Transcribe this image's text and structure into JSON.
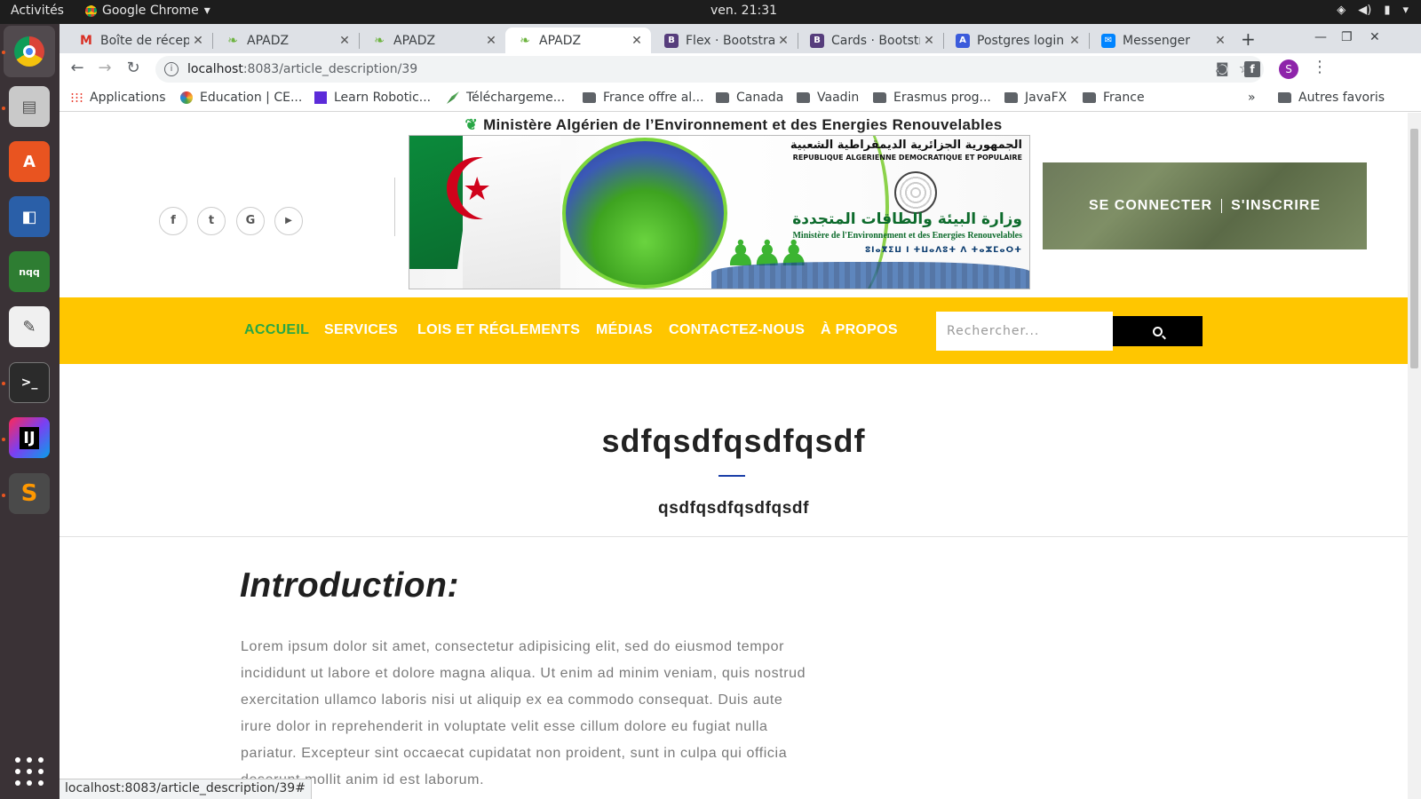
{
  "system": {
    "activities": "Activités",
    "app_name": "Google Chrome",
    "clock": "ven. 21:31"
  },
  "tabs": [
    {
      "label": "Boîte de récept",
      "icon": "gmail-icon",
      "color": "#d93025"
    },
    {
      "label": "APADZ",
      "icon": "leaf-icon",
      "color": "#6db33f"
    },
    {
      "label": "APADZ",
      "icon": "leaf-icon",
      "color": "#6db33f"
    },
    {
      "label": "APADZ",
      "icon": "leaf-icon",
      "color": "#6db33f"
    },
    {
      "label": "Flex · Bootstrap",
      "icon": "bootstrap-icon",
      "color": "#563d7c"
    },
    {
      "label": "Cards · Bootstr",
      "icon": "bootstrap-icon",
      "color": "#563d7c"
    },
    {
      "label": "Postgres login",
      "icon": "a-icon",
      "color": "#3b5bdb"
    },
    {
      "label": "Messenger",
      "icon": "messenger-icon",
      "color": "#0084ff"
    }
  ],
  "omnibox": {
    "host": "localhost",
    "path": ":8083/article_description/39"
  },
  "avatar_letter": "S",
  "bookmarks": [
    {
      "label": "Applications",
      "icon": "apps-grid-icon"
    },
    {
      "label": "Education | CE...",
      "icon": "flower-icon"
    },
    {
      "label": "Learn Robotic...",
      "icon": "e-icon"
    },
    {
      "label": "Téléchargeme...",
      "icon": "rocket-icon"
    },
    {
      "label": "France offre al...",
      "icon": "folder-icon"
    },
    {
      "label": "Canada",
      "icon": "folder-icon"
    },
    {
      "label": "Vaadin",
      "icon": "folder-icon"
    },
    {
      "label": "Erasmus prog...",
      "icon": "folder-icon"
    },
    {
      "label": "JavaFX",
      "icon": "folder-icon"
    },
    {
      "label": "France",
      "icon": "folder-icon"
    }
  ],
  "bookmarks_overflow": "»",
  "other_bookmarks": "Autres favoris",
  "site": {
    "ministry_title": "Ministère Algérien de l’Environnement et des Energies Renouvelables",
    "banner": {
      "ar_republic": "الجمهورية الجزائرية الديمقراطية الشعبية",
      "fr_republic": "REPUBLIQUE ALGERIENNE DEMOCRATIQUE ET POPULAIRE",
      "ar_ministry": "وزارة البيئة والطاقات المتجددة",
      "fr_ministry": "Ministère de l'Environnement et des Energies Renouvelables",
      "tifinagh": "ⵓⵏⴰⴳⵉⵡ ⵏ ⵜⵡⴰⴷⵓⵜ ⴷ ⵜⴰⵣⵎⴰⵔⵜ"
    },
    "social": [
      "f",
      "t",
      "G",
      "▶"
    ],
    "auth": {
      "login": "SE CONNECTER",
      "register": "S'INSCRIRE"
    },
    "nav": [
      {
        "label": "ACCUEIL",
        "active": true
      },
      {
        "label": "SERVICES",
        "active": false
      },
      {
        "label": "LOIS ET RÉGLEMENTS",
        "active": false
      },
      {
        "label": "MÉDIAS",
        "active": false
      },
      {
        "label": "CONTACTEZ-NOUS",
        "active": false
      },
      {
        "label": "À PROPOS",
        "active": false
      }
    ],
    "search_placeholder": "Rechercher...",
    "colors": {
      "nav_bg": "#ffc600",
      "active_link": "#28a745",
      "title_rule": "#1a3ea8"
    }
  },
  "article": {
    "title": "sdfqsdfqsdfqsdf",
    "subtitle": "qsdfqsdfqsdfqsdf",
    "intro_heading": "Introduction:",
    "intro_text": "Lorem ipsum dolor sit amet, consectetur adipisicing elit, sed do eiusmod tempor incididunt ut labore et dolore magna aliqua. Ut enim ad minim veniam, quis nostrud exercitation ullamco laboris nisi ut aliquip ex ea commodo consequat. Duis aute irure dolor in reprehenderit in voluptate velit esse cillum dolore eu fugiat nulla pariatur. Excepteur sint occaecat cupidatat non proident, sunt in culpa qui officia deserunt mollit anim id est laborum."
  },
  "status_url": "localhost:8083/article_description/39#"
}
